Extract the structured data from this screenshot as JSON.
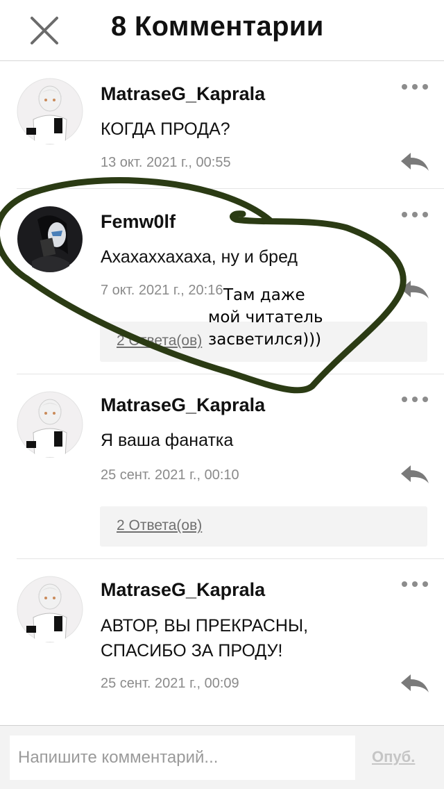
{
  "header": {
    "title": "8 Комментарии",
    "close_icon": "close-icon"
  },
  "comments": [
    {
      "author": "MatraseG_Kaprala",
      "text_lines": [
        "КОГДА ПРОДА?"
      ],
      "date": "13 окт. 2021 г., 00:55",
      "avatar": "white-haired-girl-avatar",
      "replies_label": null
    },
    {
      "author": "Femw0lf",
      "text_lines": [
        "Ахахаххахаха, ну и бред"
      ],
      "date": "7 окт. 2021 г., 20:16",
      "avatar": "dark-figure-avatar",
      "replies_label": "2 Ответа(ов)"
    },
    {
      "author": "MatraseG_Kaprala",
      "text_lines": [
        "Я ваша фанатка"
      ],
      "date": "25 сент. 2021 г., 00:10",
      "avatar": "white-haired-girl-avatar",
      "replies_label": "2 Ответа(ов)"
    },
    {
      "author": "MatraseG_Kaprala",
      "text_lines": [
        "АВТОР, ВЫ ПРЕКРАСНЫ,",
        "СПАСИБО ЗА ПРОДУ!"
      ],
      "date": "25 сент. 2021 г., 00:09",
      "avatar": "white-haired-girl-avatar",
      "replies_label": null
    }
  ],
  "footer": {
    "placeholder": "Напишите комментарий...",
    "publish_label": "Опуб."
  },
  "annotation": {
    "lines": [
      "Там даже",
      "мой читатель",
      "засветился)))"
    ],
    "stroke_color": "#2b3b14"
  },
  "colors": {
    "icon_gray": "#7f7f7f",
    "date_gray": "#8a8a8a",
    "replies_bg": "#f3f3f3"
  }
}
